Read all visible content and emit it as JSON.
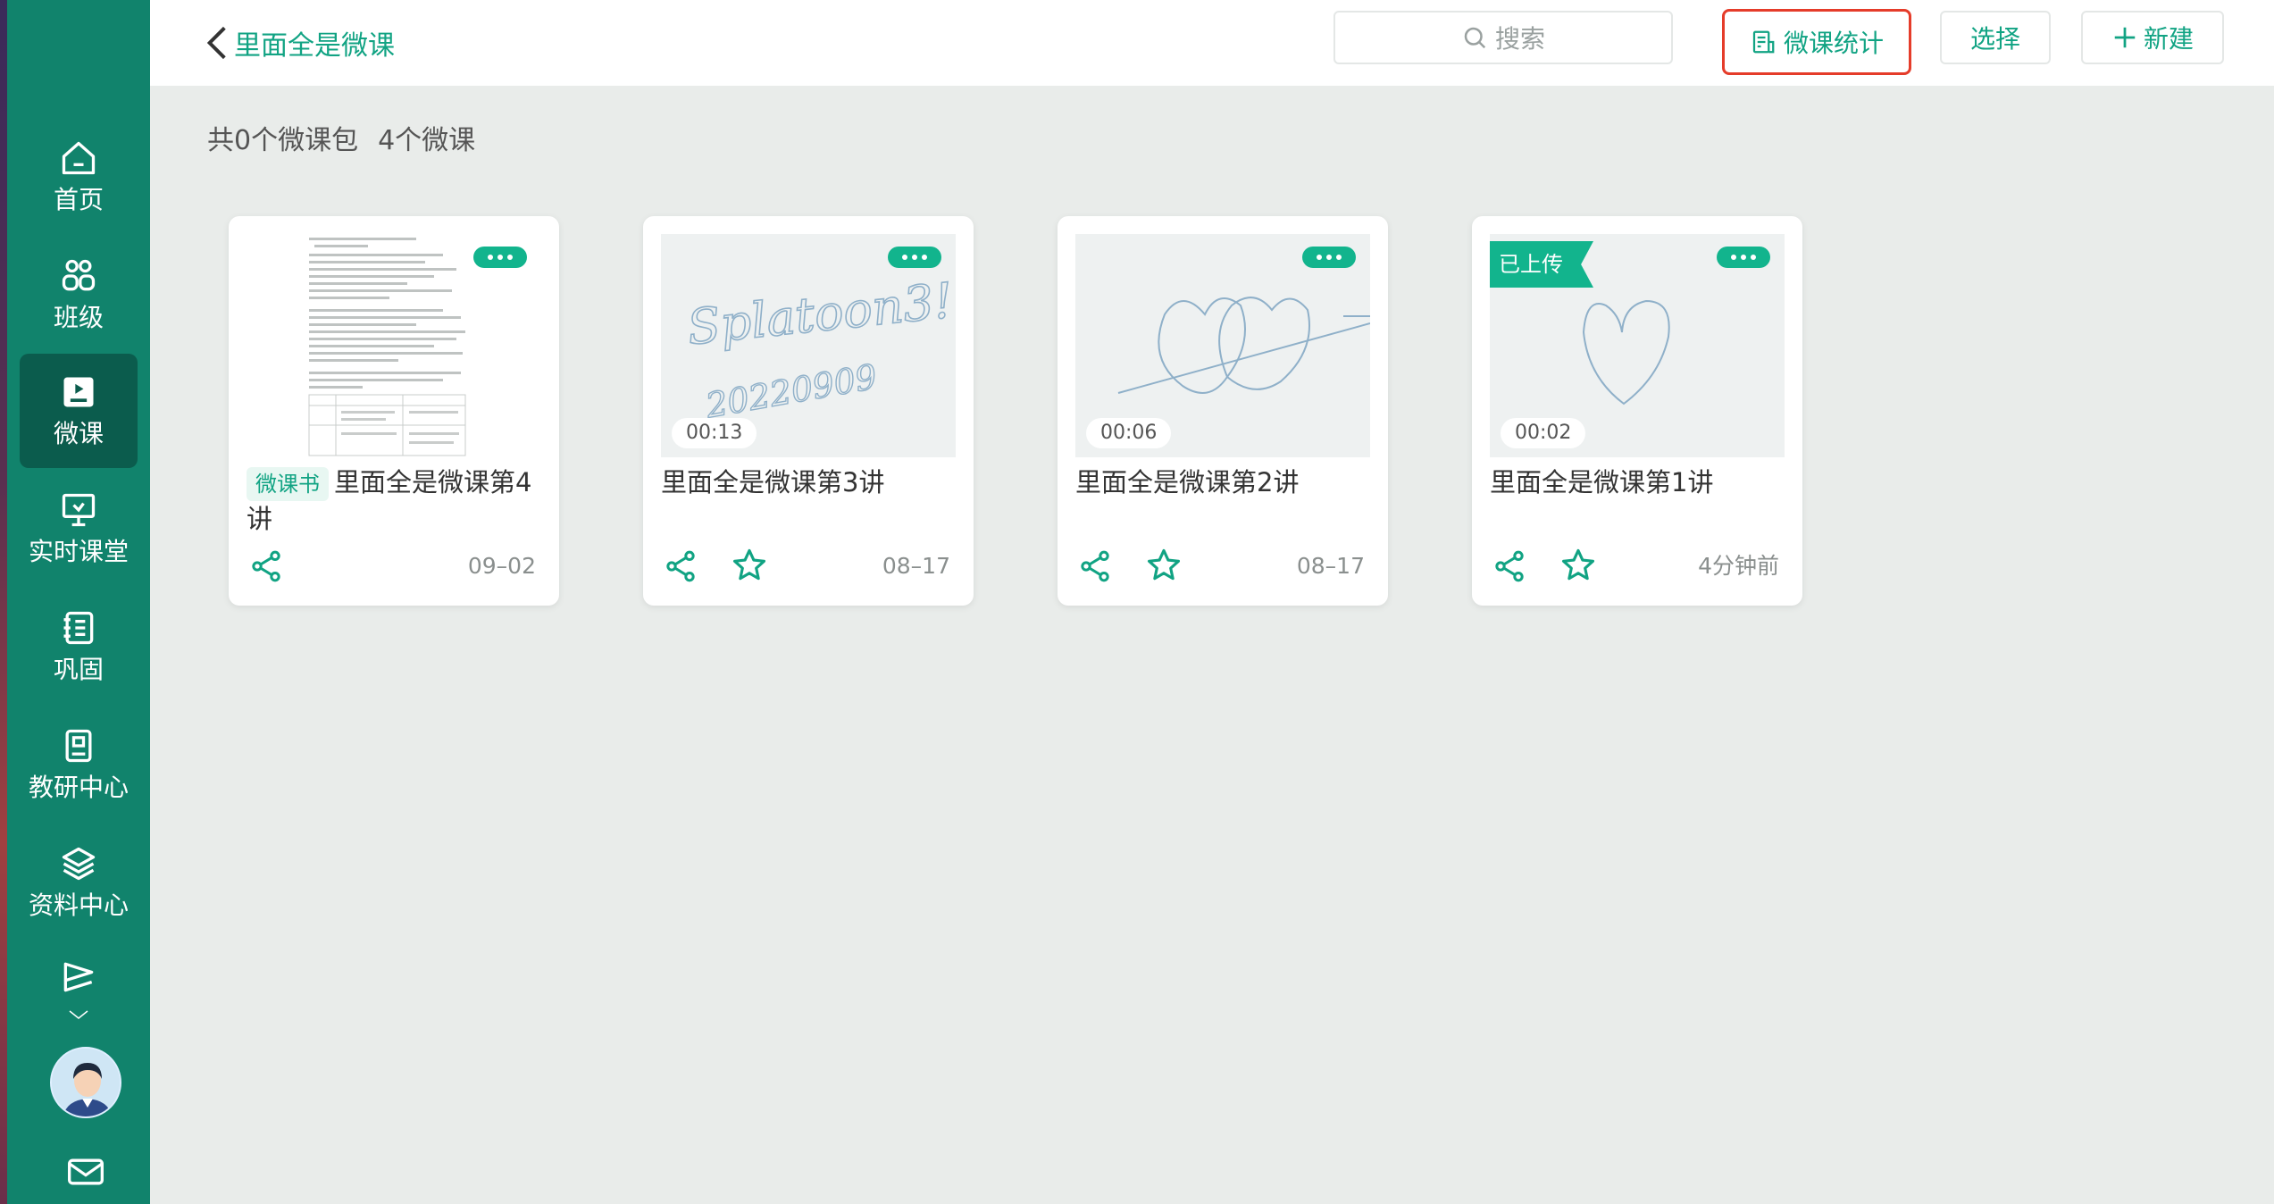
{
  "sidebar": {
    "items": [
      {
        "label": "首页",
        "icon": "home-icon"
      },
      {
        "label": "班级",
        "icon": "class-icon"
      },
      {
        "label": "微课",
        "icon": "microlesson-icon",
        "active": true
      },
      {
        "label": "实时课堂",
        "icon": "live-classroom-icon"
      },
      {
        "label": "巩固",
        "icon": "notebook-icon"
      },
      {
        "label": "教研中心",
        "icon": "research-icon"
      },
      {
        "label": "资料中心",
        "icon": "layers-icon"
      }
    ]
  },
  "header": {
    "back_label": "里面全是微课",
    "search_placeholder": "搜索",
    "stats_label": "微课统计",
    "select_label": "选择",
    "new_label": "新建"
  },
  "summary": {
    "packages": "共0个微课包",
    "lessons": "4个微课"
  },
  "cards": [
    {
      "tag": "微课书",
      "title": "里面全是微课第4讲",
      "date": "09–02",
      "duration": "",
      "uploaded": "",
      "type": "doc"
    },
    {
      "title": "里面全是微课第3讲",
      "date": "08–17",
      "duration": "00:13",
      "handwriting": "Splatoon3!",
      "handwriting2": "20220909",
      "type": "video"
    },
    {
      "title": "里面全是微课第2讲",
      "date": "08–17",
      "duration": "00:06",
      "type": "video"
    },
    {
      "title": "里面全是微课第1讲",
      "date": "4分钟前",
      "duration": "00:02",
      "uploaded": "已上传",
      "type": "video"
    }
  ],
  "colors": {
    "sidebar": "#11836c",
    "accent": "#11a383",
    "highlight_border": "#e53c2a",
    "pill": "#12b48d"
  }
}
